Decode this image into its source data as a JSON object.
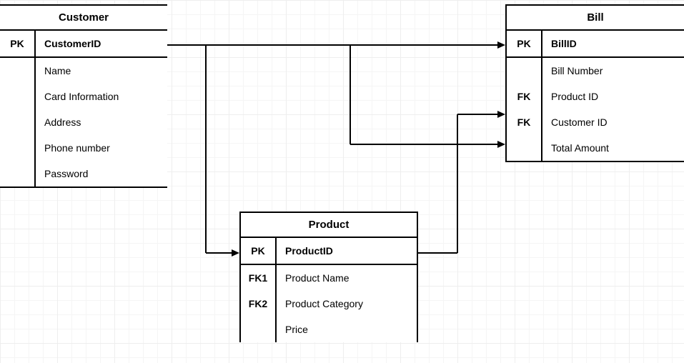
{
  "entities": {
    "customer": {
      "title": "Customer",
      "rows": [
        {
          "key": "PK",
          "attr": "CustomerID",
          "pk": true
        },
        {
          "key": "",
          "attr": "Name"
        },
        {
          "key": "",
          "attr": "Card Information"
        },
        {
          "key": "",
          "attr": "Address"
        },
        {
          "key": "",
          "attr": "Phone number"
        },
        {
          "key": "",
          "attr": "Password"
        }
      ]
    },
    "product": {
      "title": "Product",
      "rows": [
        {
          "key": "PK",
          "attr": "ProductID",
          "pk": true
        },
        {
          "key": "FK1",
          "attr": "Product Name"
        },
        {
          "key": "FK2",
          "attr": "Product Category"
        },
        {
          "key": "",
          "attr": "Price"
        }
      ]
    },
    "bill": {
      "title": "Bill",
      "rows": [
        {
          "key": "PK",
          "attr": "BillID",
          "pk": true
        },
        {
          "key": "",
          "attr": "Bill Number"
        },
        {
          "key": "FK",
          "attr": "Product ID"
        },
        {
          "key": "FK",
          "attr": "Customer ID"
        },
        {
          "key": "",
          "attr": "Total Amount"
        }
      ]
    }
  },
  "relationships": [
    {
      "from": "Customer",
      "to": "Product",
      "via": "CustomerID"
    },
    {
      "from": "Customer",
      "to": "Bill",
      "via": "Customer ID"
    },
    {
      "from": "Product",
      "to": "Bill",
      "via": "Product ID"
    }
  ]
}
